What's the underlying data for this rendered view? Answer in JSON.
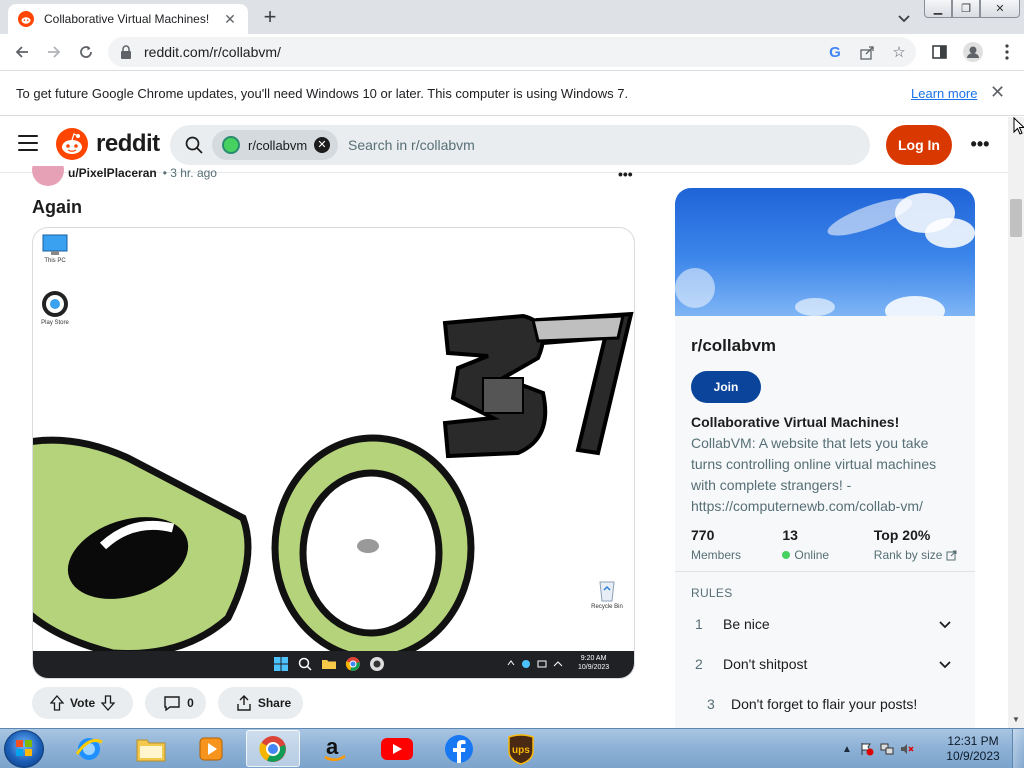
{
  "browser": {
    "tab_title": "Collaborative Virtual Machines!",
    "url": "reddit.com/r/collabvm/",
    "infobar": {
      "message": "To get future Google Chrome updates, you'll need Windows 10 or later. This computer is using Windows 7.",
      "link": "Learn more"
    }
  },
  "reddit": {
    "wordmark": "reddit",
    "search_chip": "r/collabvm",
    "search_placeholder": "Search in r/collabvm",
    "login_label": "Log In",
    "more_label": "•••"
  },
  "post": {
    "user": "u/PixelPlaceran",
    "time": "• 3 hr. ago",
    "menu": "•••",
    "title": "Again",
    "actions": {
      "vote": "Vote",
      "comments": "0",
      "share": "Share"
    },
    "media": {
      "desktop_icon_1": "This PC",
      "desktop_icon_2": "Play Store",
      "desktop_icon_3": "Recycle Bin",
      "clock_time": "9:20 AM",
      "clock_date": "10/9/2023",
      "drawing_text": "37"
    }
  },
  "sidebar": {
    "name": "r/collabvm",
    "join_label": "Join",
    "title": "Collaborative Virtual Machines!",
    "description": "CollabVM: A website that lets you take turns controlling online virtual machines with complete strangers! - https://computernewb.com/collab-vm/",
    "stats": [
      {
        "value": "770",
        "label": "Members"
      },
      {
        "value": "13",
        "label": "Online"
      },
      {
        "value": "Top 20%",
        "label": "Rank by size"
      }
    ],
    "rules_heading": "RULES",
    "rules": [
      {
        "num": "1",
        "text": "Be nice"
      },
      {
        "num": "2",
        "text": "Don't shitpost"
      },
      {
        "num": "3",
        "text": "Don't forget to flair your posts!"
      }
    ]
  },
  "taskbar": {
    "time": "12:31 PM",
    "date": "10/9/2023"
  },
  "colors": {
    "reddit_orange": "#ff4500",
    "login_bg": "#d93900",
    "join_bg": "#0a449b",
    "link_blue": "#1a73e8"
  }
}
